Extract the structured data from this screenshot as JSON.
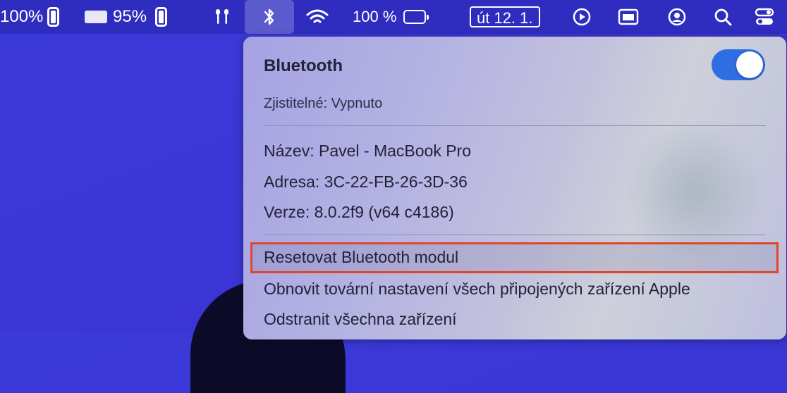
{
  "menubar": {
    "battery1_pct": "100%",
    "keyboard_battery_pct": "95%",
    "battery_pct": "100 %",
    "date": "út 12. 1."
  },
  "bluetooth_menu": {
    "title": "Bluetooth",
    "toggle_on": true,
    "discoverable": "Zjistitelné: Vypnuto",
    "name": "Název: Pavel - MacBook Pro",
    "address": "Adresa: 3C-22-FB-26-3D-36",
    "version": "Verze: 8.0.2f9 (v64 c4186)",
    "actions": [
      "Resetovat Bluetooth modul",
      "Obnovit tovární nastavení všech připojených zařízení Apple",
      "Odstranit všechna zařízení"
    ],
    "highlight_color": "#e2452c",
    "accent_color": "#2e6de2"
  }
}
